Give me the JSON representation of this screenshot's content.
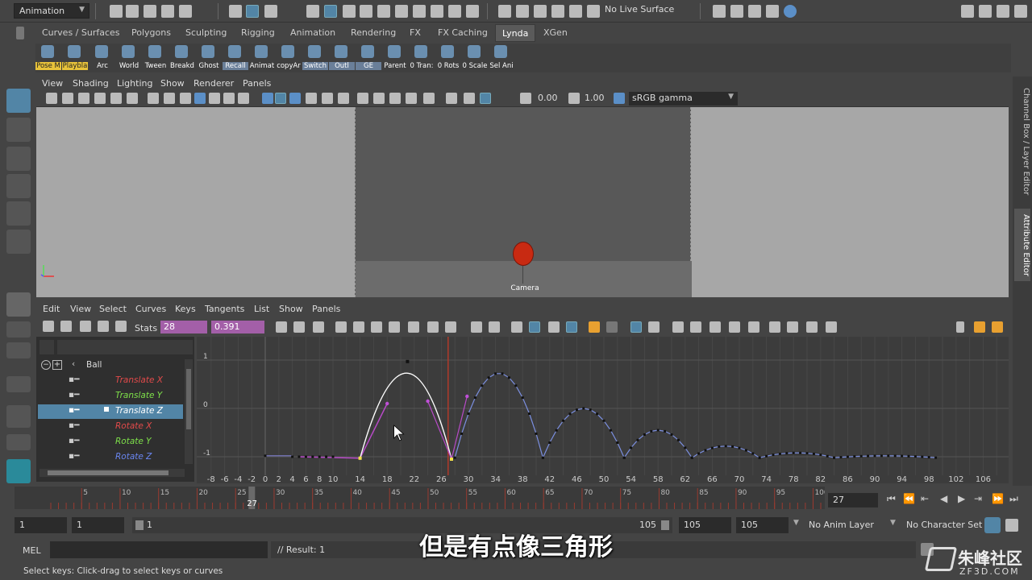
{
  "top": {
    "mode": "Animation",
    "live_surface": "No Live Surface"
  },
  "shelf_tabs": [
    "Curves / Surfaces",
    "Polygons",
    "Sculpting",
    "Rigging",
    "Animation",
    "Rendering",
    "FX",
    "FX Caching",
    "Lynda",
    "XGen"
  ],
  "shelf_items": [
    "Pose M",
    "Playbla",
    "Arc",
    "World",
    "Tween",
    "Breakd",
    "Ghost",
    "Recall",
    "Animat",
    "copyAr",
    "Switch",
    "Outl",
    "GE",
    "Parent",
    "0 Tran:",
    "0 Rots",
    "0 Scale",
    "Sel Ani"
  ],
  "viewport": {
    "menu": [
      "View",
      "Shading",
      "Lighting",
      "Show",
      "Renderer",
      "Panels"
    ],
    "exposure": "0.00",
    "gamma": "1.00",
    "colorspace": "sRGB gamma",
    "camera_label": "Camera"
  },
  "right_tabs": [
    "Channel Box / Layer Editor",
    "Attribute Editor"
  ],
  "graph_editor": {
    "menu": [
      "Edit",
      "Select",
      "Curves",
      "Keys",
      "Tangents",
      "List",
      "Show",
      "Panels"
    ],
    "stats_label": "Stats",
    "stats_value1": "28",
    "stats_value2": "0.391",
    "outliner": {
      "object": "Ball",
      "channels": [
        {
          "label": "Translate X",
          "color": "#e24a4a",
          "selected": false
        },
        {
          "label": "Translate Y",
          "color": "#7ee04a",
          "selected": false
        },
        {
          "label": "Translate Z",
          "color": "#ffffff",
          "selected": true
        },
        {
          "label": "Rotate X",
          "color": "#e24a4a",
          "selected": false
        },
        {
          "label": "Rotate Y",
          "color": "#7ee04a",
          "selected": false
        },
        {
          "label": "Rotate Z",
          "color": "#6a86f0",
          "selected": false
        }
      ]
    },
    "y_ticks": [
      "1",
      "0",
      "-1"
    ],
    "x_ticks": [
      "-8",
      "-6",
      "-4",
      "-2",
      "0",
      "2",
      "4",
      "6",
      "8",
      "10",
      "14",
      "18",
      "22",
      "26",
      "30",
      "34",
      "38",
      "42",
      "46",
      "50",
      "54",
      "58",
      "62",
      "66",
      "70",
      "74",
      "78",
      "82",
      "86",
      "90",
      "94",
      "98",
      "102",
      "106"
    ],
    "current_frame": 27
  },
  "timeline": {
    "ticks": [
      "5",
      "10",
      "15",
      "20",
      "25",
      "30",
      "35",
      "40",
      "45",
      "50",
      "55",
      "60",
      "65",
      "70",
      "75",
      "80",
      "85",
      "90",
      "95",
      "100",
      "10"
    ],
    "current_frame": "27",
    "frame_field": "27"
  },
  "range": {
    "start": "1",
    "anim_start": "1",
    "slider_start": "1",
    "slider_end": "105",
    "end": "105",
    "anim_end": "105",
    "anim_layer": "No Anim Layer",
    "character_set": "No Character Set"
  },
  "command": {
    "lang": "MEL",
    "result": "// Result: 1"
  },
  "help_text": "Select keys: Click-drag to select keys or curves",
  "subtitle": "但是有点像三角形",
  "watermark": "朱峰社区",
  "watermark_url": "ZF3D.COM"
}
